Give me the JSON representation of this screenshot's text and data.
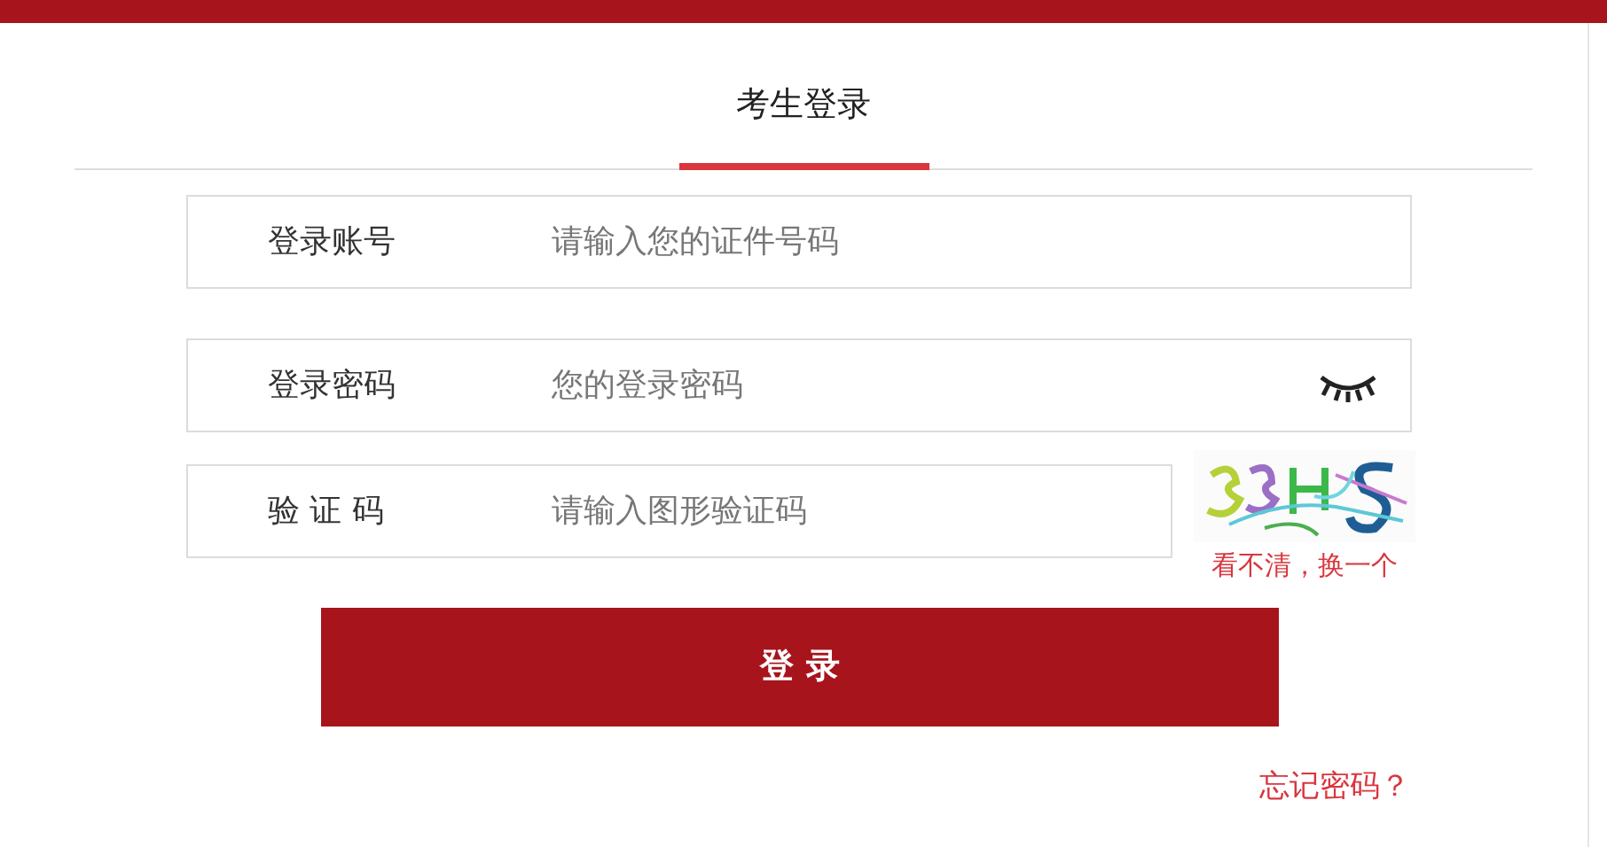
{
  "tabs": [
    {
      "label": "考生登录",
      "selected": true
    }
  ],
  "fields": [
    {
      "label": "登录账号",
      "placeholder": "请输入您的证件号码",
      "kind": "text"
    },
    {
      "label": "登录密码",
      "placeholder": "您的登录密码",
      "kind": "password"
    },
    {
      "label": "验 证 码",
      "placeholder": "请输入图形验证码",
      "kind": "captcha"
    }
  ],
  "captcha": {
    "refresh_link": "看不清，换一个"
  },
  "login_button": "登 录",
  "forgot_link": "忘记密码？"
}
